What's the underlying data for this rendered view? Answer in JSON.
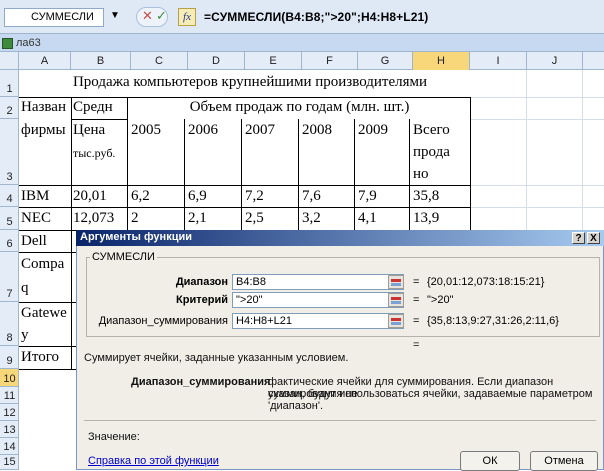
{
  "formula_bar": {
    "name_box": "СУММЕСЛИ",
    "dropdown_glyph": "▼",
    "cancel_glyph": "✕",
    "enter_glyph": "✓",
    "fx_label": "fx",
    "formula": "=СУММЕСЛИ(B4:B8;\">20\";H4:H8+L21)"
  },
  "workbook": {
    "name": "ла63"
  },
  "columns": [
    "A",
    "B",
    "C",
    "D",
    "E",
    "F",
    "G",
    "H",
    "I",
    "J"
  ],
  "rows": [
    "1",
    "2",
    "3",
    "4",
    "5",
    "6",
    "7",
    "8",
    "9",
    "10",
    "11",
    "12",
    "13",
    "14",
    "15"
  ],
  "sheet": {
    "title": "Продажа компьютеров крупнейшими производителями",
    "hdr_name_1": "Назван",
    "hdr_name_2": "фирмы",
    "hdr_avg_1": "Средн",
    "hdr_avg_2": "Цена",
    "hdr_avg_3": "тыс.руб.",
    "hdr_volume": "Объем продаж по годам (млн. шт.)",
    "years": [
      "2005",
      "2006",
      "2007",
      "2008",
      "2009"
    ],
    "total_1": "Всего",
    "total_2": "прода",
    "total_3": "но",
    "r4": [
      "IBM",
      "20,01",
      "6,2",
      "6,9",
      "7,2",
      "7,6",
      "7,9",
      "35,8"
    ],
    "r5": [
      "NEC",
      "12,073",
      "2",
      "2,1",
      "2,5",
      "3,2",
      "4,1",
      "13,9"
    ],
    "r6": "Dell",
    "r7_1": "Compa",
    "r7_2": "q",
    "r8_1": "Gatewe",
    "r8_2": "y",
    "r9": "Итого"
  },
  "dialog": {
    "title": "Аргументы функции",
    "help_glyph": "?",
    "close_glyph": "X",
    "group_label": "СУММЕСЛИ",
    "args": [
      {
        "label": "Диапазон",
        "value": "B4:B8",
        "result": "{20,01:12,073:18:15:21}"
      },
      {
        "label": "Критерий",
        "value": "\">20\"",
        "result": "\">20\""
      },
      {
        "label": "Диапазон_суммирования",
        "value": "H4:H8+L21",
        "result": "{35,8:13,9:27,31:26,2:11,6}"
      }
    ],
    "eq": "=",
    "description": "Суммирует ячейки, заданные указанным условием.",
    "arg_help_name": "Диапазон_суммирования",
    "arg_help_1": "фактические ячейки для суммирования. Если диапазон суммирования не",
    "arg_help_2": "указан, будут использоваться ячейки, задаваемые параметром",
    "arg_help_3": "'диапазон'.",
    "value_label": "Значение:",
    "help_link": "Справка по этой функции",
    "ok": "ОК",
    "cancel": "Отмена"
  },
  "colors": {
    "selected_header": "#f8d67a",
    "dialog_title_start": "#0a246a",
    "link": "#0000cc"
  }
}
